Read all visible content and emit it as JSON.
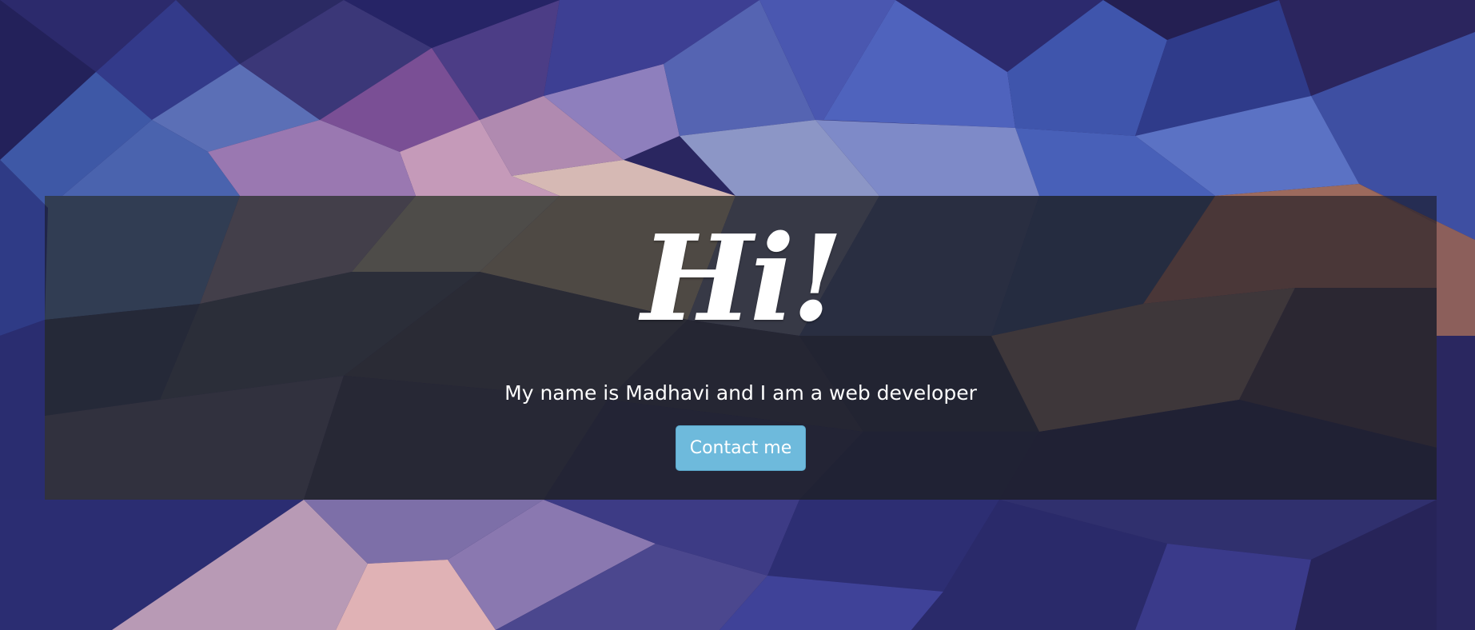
{
  "hero": {
    "title": "Hi!",
    "tagline": "My name is Madhavi and I am a web developer",
    "cta_label": "Contact me"
  },
  "colors": {
    "background_base": "#2a2660",
    "panel_overlay": "#181822",
    "button": "#6ebadc",
    "text": "#ffffff"
  }
}
